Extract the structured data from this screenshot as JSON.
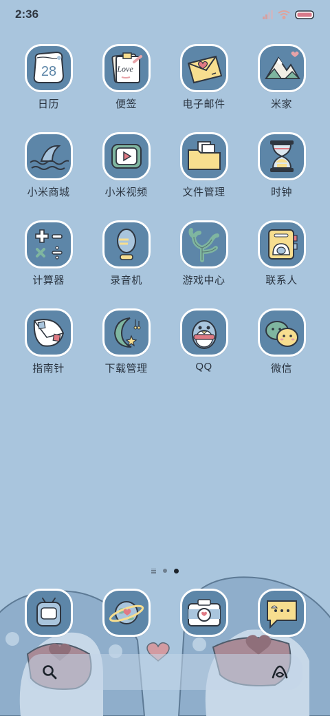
{
  "status_bar": {
    "time": "2:36"
  },
  "apps": [
    {
      "label": "日历",
      "icon": "calendar-icon",
      "day": "28"
    },
    {
      "label": "便签",
      "icon": "notes-icon",
      "note_text": "Love"
    },
    {
      "label": "电子邮件",
      "icon": "mail-icon"
    },
    {
      "label": "米家",
      "icon": "mountain-home-icon"
    },
    {
      "label": "小米商城",
      "icon": "shark-fin-icon"
    },
    {
      "label": "小米视频",
      "icon": "video-player-icon"
    },
    {
      "label": "文件管理",
      "icon": "folder-icon"
    },
    {
      "label": "时钟",
      "icon": "hourglass-icon"
    },
    {
      "label": "计算器",
      "icon": "calculator-icon"
    },
    {
      "label": "录音机",
      "icon": "microphone-icon"
    },
    {
      "label": "游戏中心",
      "icon": "coral-icon"
    },
    {
      "label": "联系人",
      "icon": "contacts-icon"
    },
    {
      "label": "指南针",
      "icon": "compass-icon"
    },
    {
      "label": "下载管理",
      "icon": "moon-download-icon"
    },
    {
      "label": "QQ",
      "icon": "penguin-icon"
    },
    {
      "label": "微信",
      "icon": "chat-bubbles-icon"
    }
  ],
  "pages": {
    "count": 2,
    "current": 2
  },
  "dock": [
    {
      "icon": "tv-phone-icon"
    },
    {
      "icon": "planet-browser-icon"
    },
    {
      "icon": "camera-icon"
    },
    {
      "icon": "message-bubble-icon"
    }
  ],
  "search_bar": {
    "left_icon": "search-icon",
    "right_icon": "assistant-icon"
  },
  "colors": {
    "background": "#a9c5dd",
    "icon_tile": "#5d86a8",
    "icon_border": "#ffffff",
    "accent_yellow": "#f7de8f",
    "accent_pink": "#e7a3a8"
  }
}
